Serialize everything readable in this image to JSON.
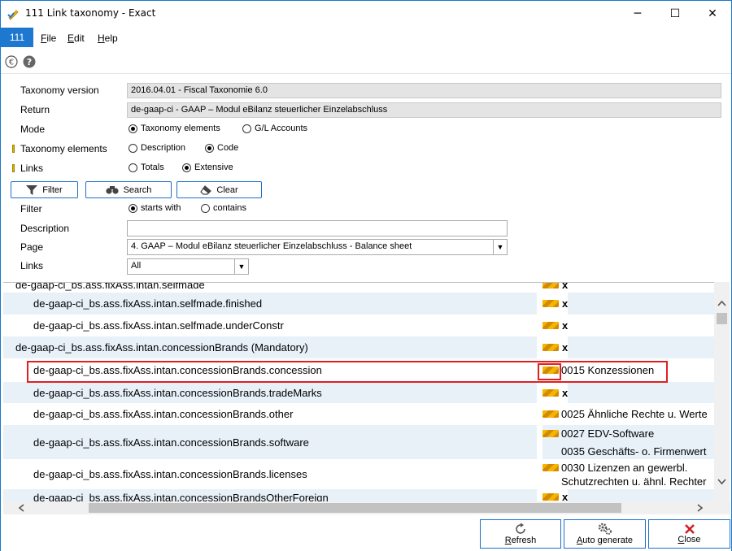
{
  "window": {
    "title": "111 Link taxonomy - Exact",
    "minimize": "─",
    "maximize": "☐",
    "close": "✕"
  },
  "menubar": {
    "module": "111",
    "items": [
      {
        "label": "File",
        "accel": "F",
        "rest": "ile"
      },
      {
        "label": "Edit",
        "accel": "E",
        "rest": "dit"
      },
      {
        "label": "Help",
        "accel": "H",
        "rest": "elp"
      }
    ]
  },
  "toolbar": {
    "euro_icon": "euro-icon",
    "help_icon": "help-icon"
  },
  "form": {
    "taxonomy_version_label": "Taxonomy version",
    "taxonomy_version_value": "2016.04.01 - Fiscal Taxonomie 6.0",
    "return_label": "Return",
    "return_value": "de-gaap-ci - GAAP – Modul eBilanz steuerlicher Einzelabschluss",
    "mode_label": "Mode",
    "mode_options": [
      "Taxonomy elements",
      "G/L Accounts"
    ],
    "mode_selected": 0,
    "taxonomy_elements_label": "Taxonomy elements",
    "taxonomy_elements_options": [
      "Description",
      "Code"
    ],
    "taxonomy_elements_selected": 1,
    "links_label": "Links",
    "links_options": [
      "Totals",
      "Extensive"
    ],
    "links_selected": 1,
    "filter_button": "Filter",
    "search_button": "Search",
    "clear_button": "Clear",
    "filter_label": "Filter",
    "filter_options": [
      "starts with",
      "contains"
    ],
    "filter_selected": 0,
    "description_label": "Description",
    "description_value": "",
    "page_label": "Page",
    "page_value": "4.  GAAP – Modul eBilanz steuerlicher Einzelabschluss - Balance sheet",
    "links2_label": "Links",
    "links2_value": "All"
  },
  "grid": {
    "rows": [
      {
        "name": "de-gaap-ci_bs.ass.fixAss.intan.selfmade",
        "indent": 1,
        "link": "x"
      },
      {
        "name": "de-gaap-ci_bs.ass.fixAss.intan.selfmade.finished",
        "indent": 2,
        "link": "x"
      },
      {
        "name": "de-gaap-ci_bs.ass.fixAss.intan.selfmade.underConstr",
        "indent": 2,
        "link": "x"
      },
      {
        "name": "de-gaap-ci_bs.ass.fixAss.intan.concessionBrands (Mandatory)",
        "indent": 1,
        "link": "x"
      },
      {
        "name": "de-gaap-ci_bs.ass.fixAss.intan.concessionBrands.concession",
        "indent": 2,
        "link": "0015 Konzessionen"
      },
      {
        "name": "de-gaap-ci_bs.ass.fixAss.intan.concessionBrands.tradeMarks",
        "indent": 2,
        "link": "x"
      },
      {
        "name": "de-gaap-ci_bs.ass.fixAss.intan.concessionBrands.other",
        "indent": 2,
        "link": "0025 Ähnliche Rechte u. Werte"
      },
      {
        "name": "de-gaap-ci_bs.ass.fixAss.intan.concessionBrands.software",
        "indent": 2,
        "link": "0027 EDV-Software",
        "link2": "0035 Geschäfts- o. Firmenwert"
      },
      {
        "name": "de-gaap-ci_bs.ass.fixAss.intan.concessionBrands.licenses",
        "indent": 2,
        "link": "0030 Lizenzen an gewerbl.",
        "link2": "Schutzrechten u. ähnl. Rechter"
      },
      {
        "name": "de-gaap-ci_bs.ass.fixAss.intan.concessionBrandsOtherForeign",
        "indent": 2,
        "link": "x"
      }
    ]
  },
  "bottom": {
    "refresh_button": "Refresh",
    "refresh_accel": "R",
    "refresh_rest": "efresh",
    "autogen_button": "Auto generate",
    "autogen_accel": "A",
    "autogen_rest": "uto generate",
    "close_button": "Close",
    "close_accel": "C",
    "close_rest": "lose"
  },
  "colors": {
    "accent": "#1e78d0",
    "alt_row": "#e8f1f8",
    "highlight": "#e02020",
    "close_icon": "#d02020",
    "refresh_icon": "#555555"
  }
}
